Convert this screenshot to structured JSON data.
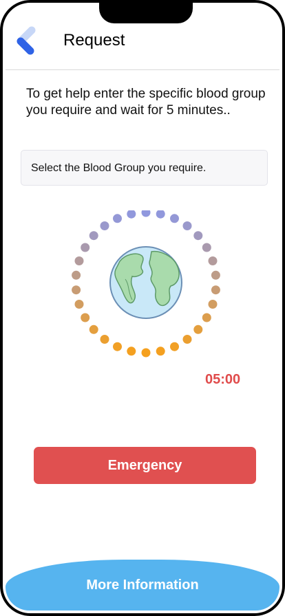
{
  "header": {
    "title": "Request",
    "back_icon": "chevron-left-icon"
  },
  "instructions": "To get help enter the specific blood group you require and wait for 5 minutes..",
  "blood_group_select": {
    "value": "Select the Blood Group you require."
  },
  "globe": {
    "icon": "globe-icon"
  },
  "timer": {
    "value": "05:00"
  },
  "buttons": {
    "emergency": "Emergency",
    "more_info": "More Information"
  },
  "colors": {
    "emergency": "#e05050",
    "more_info": "#56b4ef",
    "timer": "#e04b4b",
    "back_icon_light": "#c7d7f7",
    "back_icon_dark": "#2f63e6"
  }
}
